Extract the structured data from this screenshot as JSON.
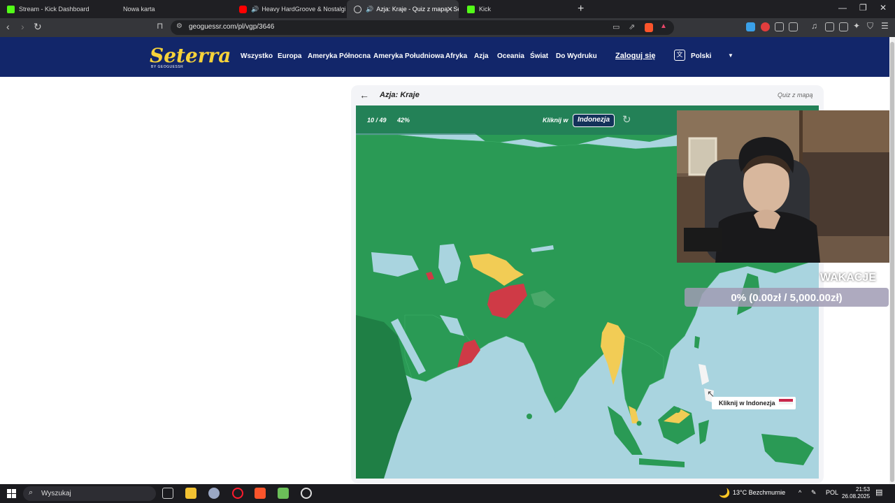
{
  "browser": {
    "tabs": [
      {
        "label": "Stream - Kick Dashboard"
      },
      {
        "label": "Nowa karta"
      },
      {
        "label": "Heavy HardGroove & Nostalgic T"
      },
      {
        "label": "Azja: Kraje - Quiz z mapą - Se"
      },
      {
        "label": "Kick"
      }
    ],
    "url": "geoguessr.com/pl/vgp/3646"
  },
  "site": {
    "logo": "Seterra",
    "logo_sub": "BY GEOGUESSR",
    "nav": [
      "Wszystko",
      "Europa",
      "Ameryka Północna",
      "Ameryka Południowa",
      "Afryka",
      "Azja",
      "Oceania",
      "Świat",
      "Do Wydruku"
    ],
    "login": "Zaloguj się",
    "language": "Polski"
  },
  "quiz": {
    "title": "Azja: Kraje",
    "mode": "Quiz z mapą",
    "progress": "10 / 49",
    "percent": "42%",
    "prompt_label": "Kliknij w",
    "target": "Indonezja",
    "tooltip": "Kliknij w Indonezja"
  },
  "overlay": {
    "donation_title": "WAKACJE",
    "donation_progress": "0% (0.00zł / 5,000.00zł)"
  },
  "taskbar": {
    "search_placeholder": "Wyszukaj",
    "weather": "13°C  Bezchmurnie",
    "language": "POL",
    "time": "21:53",
    "date": "26.08.2025"
  },
  "colors": {
    "nav_bg": "#12266a",
    "logo": "#f6d23a",
    "land": "#2a9a55",
    "land_dark": "#1f7f45",
    "wrong": "#cf3a46",
    "partial": "#f2cc55",
    "sea": "#a9d4df"
  }
}
